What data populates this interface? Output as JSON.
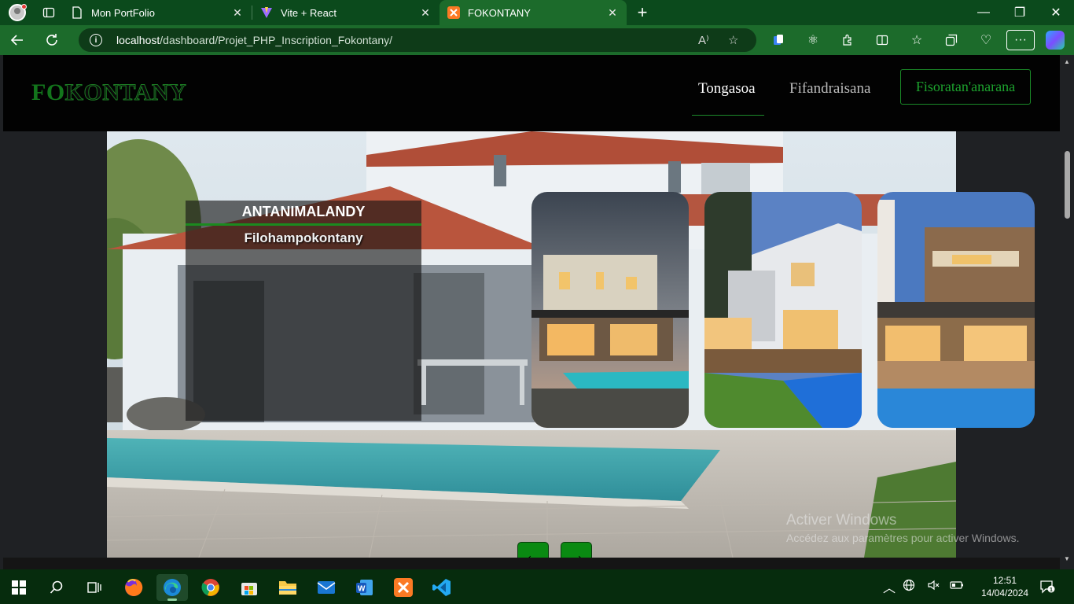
{
  "browser": {
    "tabs": [
      {
        "title": "Mon PortFolio",
        "icon": "page-icon"
      },
      {
        "title": "Vite + React",
        "icon": "vite-icon"
      },
      {
        "title": "FOKONTANY",
        "icon": "xampp-icon",
        "active": true
      }
    ],
    "url": {
      "host": "localhost",
      "path": "/dashboard/Projet_PHP_Inscription_Fokontany/"
    }
  },
  "site": {
    "brand": {
      "part1": "FO",
      "part2": "KONTANY"
    },
    "nav": {
      "home": "Tongasoa",
      "register": "Fifandraisana",
      "signup": "Fisoratan'anarana"
    },
    "hero": {
      "title": "ANTANIMALANDY",
      "subtitle": "Filohampokontany"
    },
    "slider": {
      "prev": "←",
      "next": "→"
    }
  },
  "watermark": {
    "line1": "Activer Windows",
    "line2": "Accédez aux paramètres pour activer Windows."
  },
  "taskbar": {
    "time": "12:51",
    "date": "14/04/2024",
    "notification_count": "1"
  },
  "colors": {
    "browser_frame": "#1c6b2b",
    "brand_green": "#13751c",
    "button_green": "#0a8a12"
  }
}
